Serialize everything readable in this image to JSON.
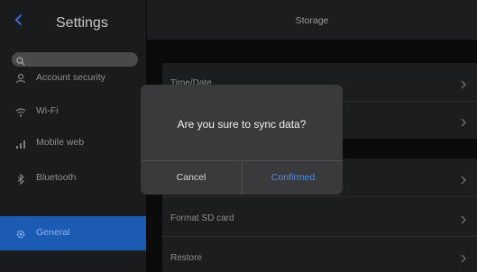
{
  "sidebar": {
    "title": "Settings",
    "items": [
      {
        "label": "Account security",
        "icon": "person-icon"
      },
      {
        "label": "Wi-Fi",
        "icon": "wifi-icon"
      },
      {
        "label": "Mobile web",
        "icon": "signal-icon"
      },
      {
        "label": "Bluetooth",
        "icon": "bluetooth-icon"
      },
      {
        "label": "General",
        "icon": "gear-icon",
        "active": true
      }
    ]
  },
  "main": {
    "title": "Storage",
    "rows": [
      {
        "label": "Time/Date"
      },
      {
        "label": ""
      },
      {
        "label": ""
      },
      {
        "label": "Format SD card"
      },
      {
        "label": "Restore"
      }
    ]
  },
  "dialog": {
    "message": "Are you sure to sync data?",
    "cancel_label": "Cancel",
    "confirm_label": "Confirmed"
  },
  "colors": {
    "accent": "#1b5bb4",
    "confirm": "#4d8ef0"
  }
}
